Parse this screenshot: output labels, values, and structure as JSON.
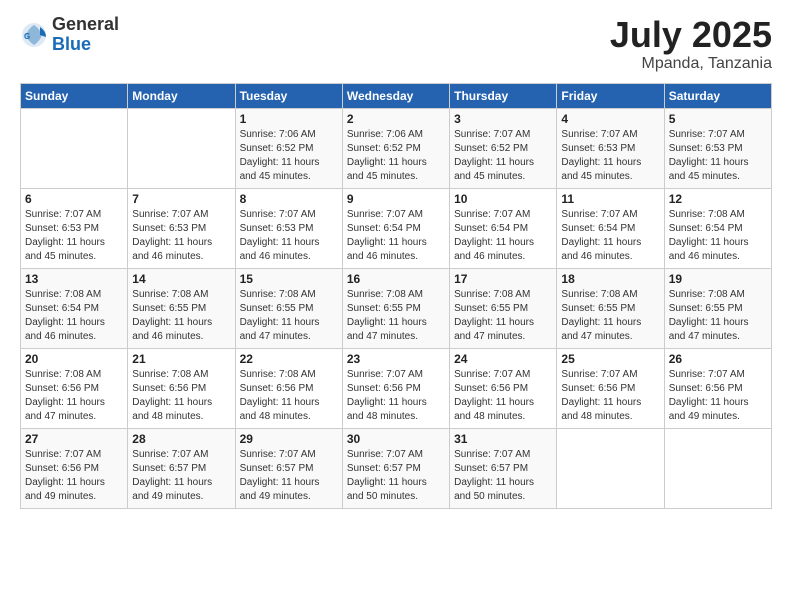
{
  "logo": {
    "general": "General",
    "blue": "Blue"
  },
  "title": "July 2025",
  "location": "Mpanda, Tanzania",
  "days_of_week": [
    "Sunday",
    "Monday",
    "Tuesday",
    "Wednesday",
    "Thursday",
    "Friday",
    "Saturday"
  ],
  "weeks": [
    [
      {
        "day": "",
        "content": ""
      },
      {
        "day": "",
        "content": ""
      },
      {
        "day": "1",
        "content": "Sunrise: 7:06 AM\nSunset: 6:52 PM\nDaylight: 11 hours\nand 45 minutes."
      },
      {
        "day": "2",
        "content": "Sunrise: 7:06 AM\nSunset: 6:52 PM\nDaylight: 11 hours\nand 45 minutes."
      },
      {
        "day": "3",
        "content": "Sunrise: 7:07 AM\nSunset: 6:52 PM\nDaylight: 11 hours\nand 45 minutes."
      },
      {
        "day": "4",
        "content": "Sunrise: 7:07 AM\nSunset: 6:53 PM\nDaylight: 11 hours\nand 45 minutes."
      },
      {
        "day": "5",
        "content": "Sunrise: 7:07 AM\nSunset: 6:53 PM\nDaylight: 11 hours\nand 45 minutes."
      }
    ],
    [
      {
        "day": "6",
        "content": "Sunrise: 7:07 AM\nSunset: 6:53 PM\nDaylight: 11 hours\nand 45 minutes."
      },
      {
        "day": "7",
        "content": "Sunrise: 7:07 AM\nSunset: 6:53 PM\nDaylight: 11 hours\nand 46 minutes."
      },
      {
        "day": "8",
        "content": "Sunrise: 7:07 AM\nSunset: 6:53 PM\nDaylight: 11 hours\nand 46 minutes."
      },
      {
        "day": "9",
        "content": "Sunrise: 7:07 AM\nSunset: 6:54 PM\nDaylight: 11 hours\nand 46 minutes."
      },
      {
        "day": "10",
        "content": "Sunrise: 7:07 AM\nSunset: 6:54 PM\nDaylight: 11 hours\nand 46 minutes."
      },
      {
        "day": "11",
        "content": "Sunrise: 7:07 AM\nSunset: 6:54 PM\nDaylight: 11 hours\nand 46 minutes."
      },
      {
        "day": "12",
        "content": "Sunrise: 7:08 AM\nSunset: 6:54 PM\nDaylight: 11 hours\nand 46 minutes."
      }
    ],
    [
      {
        "day": "13",
        "content": "Sunrise: 7:08 AM\nSunset: 6:54 PM\nDaylight: 11 hours\nand 46 minutes."
      },
      {
        "day": "14",
        "content": "Sunrise: 7:08 AM\nSunset: 6:55 PM\nDaylight: 11 hours\nand 46 minutes."
      },
      {
        "day": "15",
        "content": "Sunrise: 7:08 AM\nSunset: 6:55 PM\nDaylight: 11 hours\nand 47 minutes."
      },
      {
        "day": "16",
        "content": "Sunrise: 7:08 AM\nSunset: 6:55 PM\nDaylight: 11 hours\nand 47 minutes."
      },
      {
        "day": "17",
        "content": "Sunrise: 7:08 AM\nSunset: 6:55 PM\nDaylight: 11 hours\nand 47 minutes."
      },
      {
        "day": "18",
        "content": "Sunrise: 7:08 AM\nSunset: 6:55 PM\nDaylight: 11 hours\nand 47 minutes."
      },
      {
        "day": "19",
        "content": "Sunrise: 7:08 AM\nSunset: 6:55 PM\nDaylight: 11 hours\nand 47 minutes."
      }
    ],
    [
      {
        "day": "20",
        "content": "Sunrise: 7:08 AM\nSunset: 6:56 PM\nDaylight: 11 hours\nand 47 minutes."
      },
      {
        "day": "21",
        "content": "Sunrise: 7:08 AM\nSunset: 6:56 PM\nDaylight: 11 hours\nand 48 minutes."
      },
      {
        "day": "22",
        "content": "Sunrise: 7:08 AM\nSunset: 6:56 PM\nDaylight: 11 hours\nand 48 minutes."
      },
      {
        "day": "23",
        "content": "Sunrise: 7:07 AM\nSunset: 6:56 PM\nDaylight: 11 hours\nand 48 minutes."
      },
      {
        "day": "24",
        "content": "Sunrise: 7:07 AM\nSunset: 6:56 PM\nDaylight: 11 hours\nand 48 minutes."
      },
      {
        "day": "25",
        "content": "Sunrise: 7:07 AM\nSunset: 6:56 PM\nDaylight: 11 hours\nand 48 minutes."
      },
      {
        "day": "26",
        "content": "Sunrise: 7:07 AM\nSunset: 6:56 PM\nDaylight: 11 hours\nand 49 minutes."
      }
    ],
    [
      {
        "day": "27",
        "content": "Sunrise: 7:07 AM\nSunset: 6:56 PM\nDaylight: 11 hours\nand 49 minutes."
      },
      {
        "day": "28",
        "content": "Sunrise: 7:07 AM\nSunset: 6:57 PM\nDaylight: 11 hours\nand 49 minutes."
      },
      {
        "day": "29",
        "content": "Sunrise: 7:07 AM\nSunset: 6:57 PM\nDaylight: 11 hours\nand 49 minutes."
      },
      {
        "day": "30",
        "content": "Sunrise: 7:07 AM\nSunset: 6:57 PM\nDaylight: 11 hours\nand 50 minutes."
      },
      {
        "day": "31",
        "content": "Sunrise: 7:07 AM\nSunset: 6:57 PM\nDaylight: 11 hours\nand 50 minutes."
      },
      {
        "day": "",
        "content": ""
      },
      {
        "day": "",
        "content": ""
      }
    ]
  ]
}
